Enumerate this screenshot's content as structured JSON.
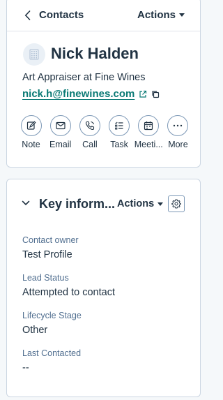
{
  "header": {
    "title": "Contacts",
    "actions_label": "Actions"
  },
  "contact": {
    "name": "Nick Halden",
    "job_title": "Art Appraiser at Fine Wines",
    "email": "nick.h@finewines.com"
  },
  "quick_actions": [
    {
      "label": "Note",
      "icon": "note-icon"
    },
    {
      "label": "Email",
      "icon": "email-icon"
    },
    {
      "label": "Call",
      "icon": "call-icon"
    },
    {
      "label": "Task",
      "icon": "task-icon"
    },
    {
      "label": "Meeti...",
      "icon": "meeting-icon"
    },
    {
      "label": "More",
      "icon": "more-icon"
    }
  ],
  "key_info": {
    "title": "Key inform...",
    "actions_label": "Actions",
    "fields": [
      {
        "label": "Contact owner",
        "value": "Test Profile"
      },
      {
        "label": "Lead Status",
        "value": "Attempted to contact"
      },
      {
        "label": "Lifecycle Stage",
        "value": "Other"
      },
      {
        "label": "Last Contacted",
        "value": "--"
      }
    ]
  },
  "colors": {
    "link": "#0b7a75",
    "text": "#213343",
    "border": "#cbd6e2",
    "muted": "#516f90"
  }
}
